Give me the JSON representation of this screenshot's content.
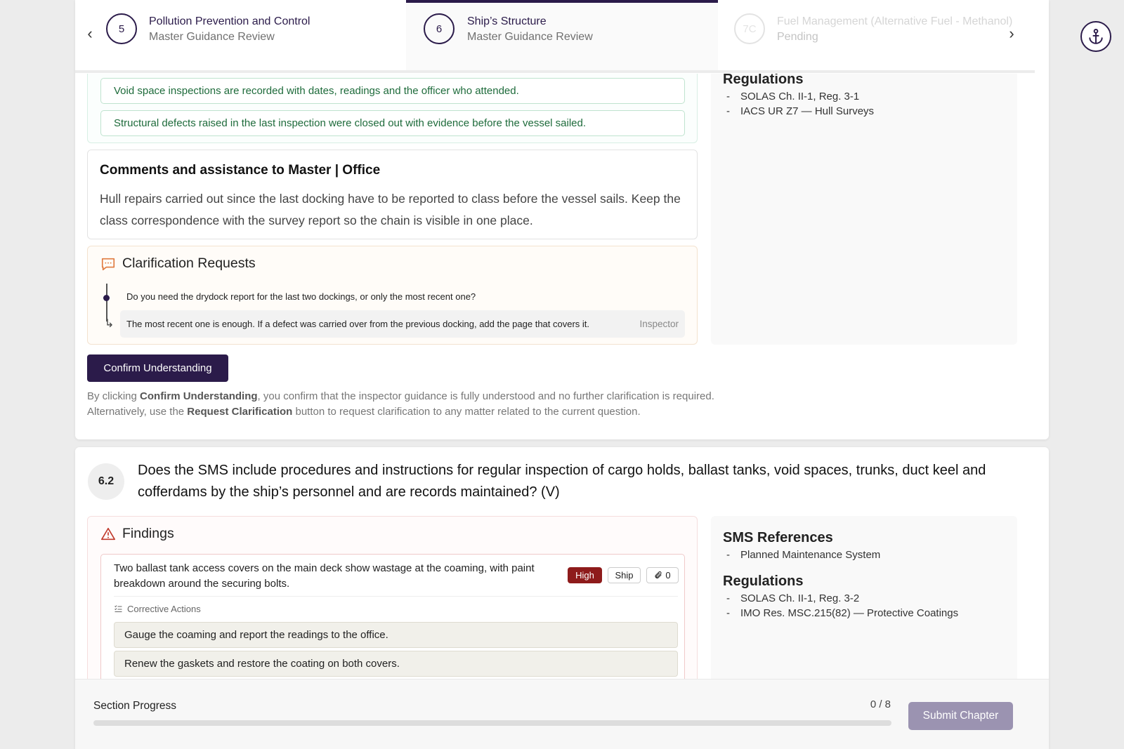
{
  "chapters": [
    {
      "number": "5",
      "title": "Pollution Prevention and Control",
      "status": "Master Guidance Review"
    },
    {
      "number": "6",
      "title": "Ship’s Structure",
      "status": "Master Guidance Review"
    },
    {
      "number": "7C",
      "title": "Fuel Management (Alternative Fuel - Methanol)",
      "status": "Pending"
    }
  ],
  "q1": {
    "checklist": [
      "Void space inspections are recorded with dates, readings and the officer who attended.",
      "Structural defects raised in the last inspection were closed out with evidence before the vessel sailed."
    ],
    "comments_heading": "Comments and assistance to Master | Office",
    "comments_text": "Hull repairs carried out since the last docking have to be reported to class before the vessel sails. Keep the class correspondence with the survey report so the chain is visible in one place.",
    "clarification_heading": "Clarification Requests",
    "clarification_question": "Do you need the drydock report for the last two dockings, or only the most recent one?",
    "clarification_answer": "The most recent one is enough. If a defect was carried over from the previous docking, add the page that covers it.",
    "clarification_answer_role": "Inspector",
    "confirm_label": "Confirm Understanding",
    "note_pre1": "By clicking ",
    "note_bold1": "Confirm Understanding",
    "note_post1": ", you confirm that the inspector guidance is fully understood and no further clarification is required.",
    "note_pre2": "Alternatively, use the ",
    "note_bold2": "Request Clarification",
    "note_post2": " button to request clarification to any matter related to the current question.",
    "regulations_heading": "Regulations",
    "regulations": [
      "SOLAS Ch. II-1, Reg. 3-1",
      "IACS UR Z7 — Hull Surveys"
    ]
  },
  "q2": {
    "number": "6.2",
    "question": "Does the SMS include procedures and instructions for regular inspection of cargo holds, ballast tanks, void spaces, trunks, duct keel and cofferdams by the ship’s personnel and are records maintained? (V)",
    "findings_heading": "Findings",
    "finding_text": "Two ballast tank access covers on the main deck show wastage at the coaming, with paint breakdown around the securing bolts.",
    "severity": "High",
    "responsible": "Ship",
    "attachments": "0",
    "corrective_heading": "Corrective Actions",
    "corrective_actions": [
      "Gauge the coaming and report the readings to the office.",
      "Renew the gaskets and restore the coating on both covers."
    ],
    "sms_heading": "SMS References",
    "sms_refs": [
      "Planned Maintenance System"
    ],
    "regulations_heading": "Regulations",
    "regulations": [
      "SOLAS Ch. II-1, Reg. 3-2",
      "IMO Res. MSC.215(82) — Protective Coatings"
    ]
  },
  "footer": {
    "progress_label": "Section Progress",
    "progress_count": "0 / 8",
    "progress_fraction": 0,
    "submit_label": "Submit Chapter"
  },
  "colors": {
    "primary": "#2b1b4a",
    "accent_orange": "#e07a3f",
    "severity_high": "#8e1b1b",
    "success_text": "#1e6b3b"
  }
}
